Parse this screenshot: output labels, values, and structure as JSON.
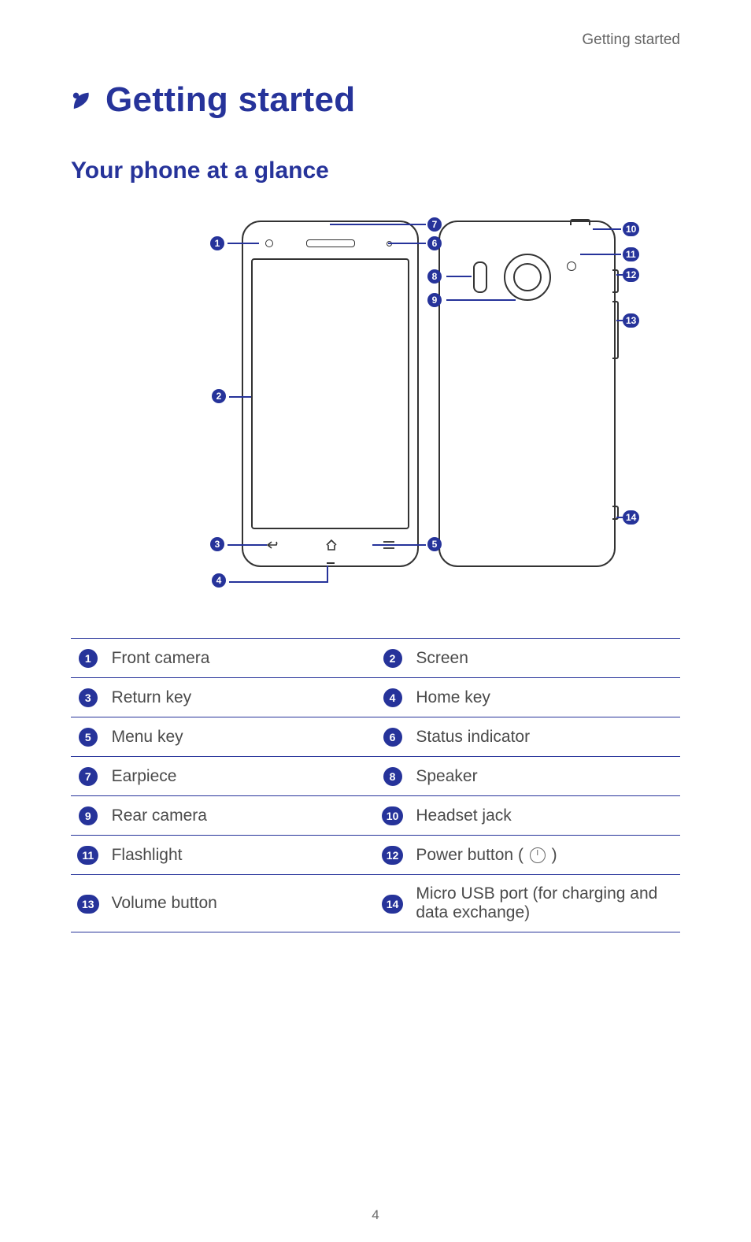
{
  "running_head": "Getting started",
  "chapter_title": "Getting started",
  "section_title": "Your phone at a glance",
  "page_number": "4",
  "callouts": {
    "c1": "1",
    "c2": "2",
    "c3": "3",
    "c4": "4",
    "c5": "5",
    "c6": "6",
    "c7": "7",
    "c8": "8",
    "c9": "9",
    "c10": "10",
    "c11": "11",
    "c12": "12",
    "c13": "13",
    "c14": "14"
  },
  "legend": [
    {
      "n": "1",
      "label": "Front camera"
    },
    {
      "n": "2",
      "label": "Screen"
    },
    {
      "n": "3",
      "label": "Return key"
    },
    {
      "n": "4",
      "label": "Home key"
    },
    {
      "n": "5",
      "label": "Menu key"
    },
    {
      "n": "6",
      "label": "Status indicator"
    },
    {
      "n": "7",
      "label": "Earpiece"
    },
    {
      "n": "8",
      "label": "Speaker"
    },
    {
      "n": "9",
      "label": "Rear camera"
    },
    {
      "n": "10",
      "label": "Headset jack"
    },
    {
      "n": "11",
      "label": "Flashlight"
    },
    {
      "n": "12",
      "label": "Power button (",
      "suffix": ")"
    },
    {
      "n": "13",
      "label": "Volume button"
    },
    {
      "n": "14",
      "label": "Micro USB port (for charging and data exchange)"
    }
  ]
}
